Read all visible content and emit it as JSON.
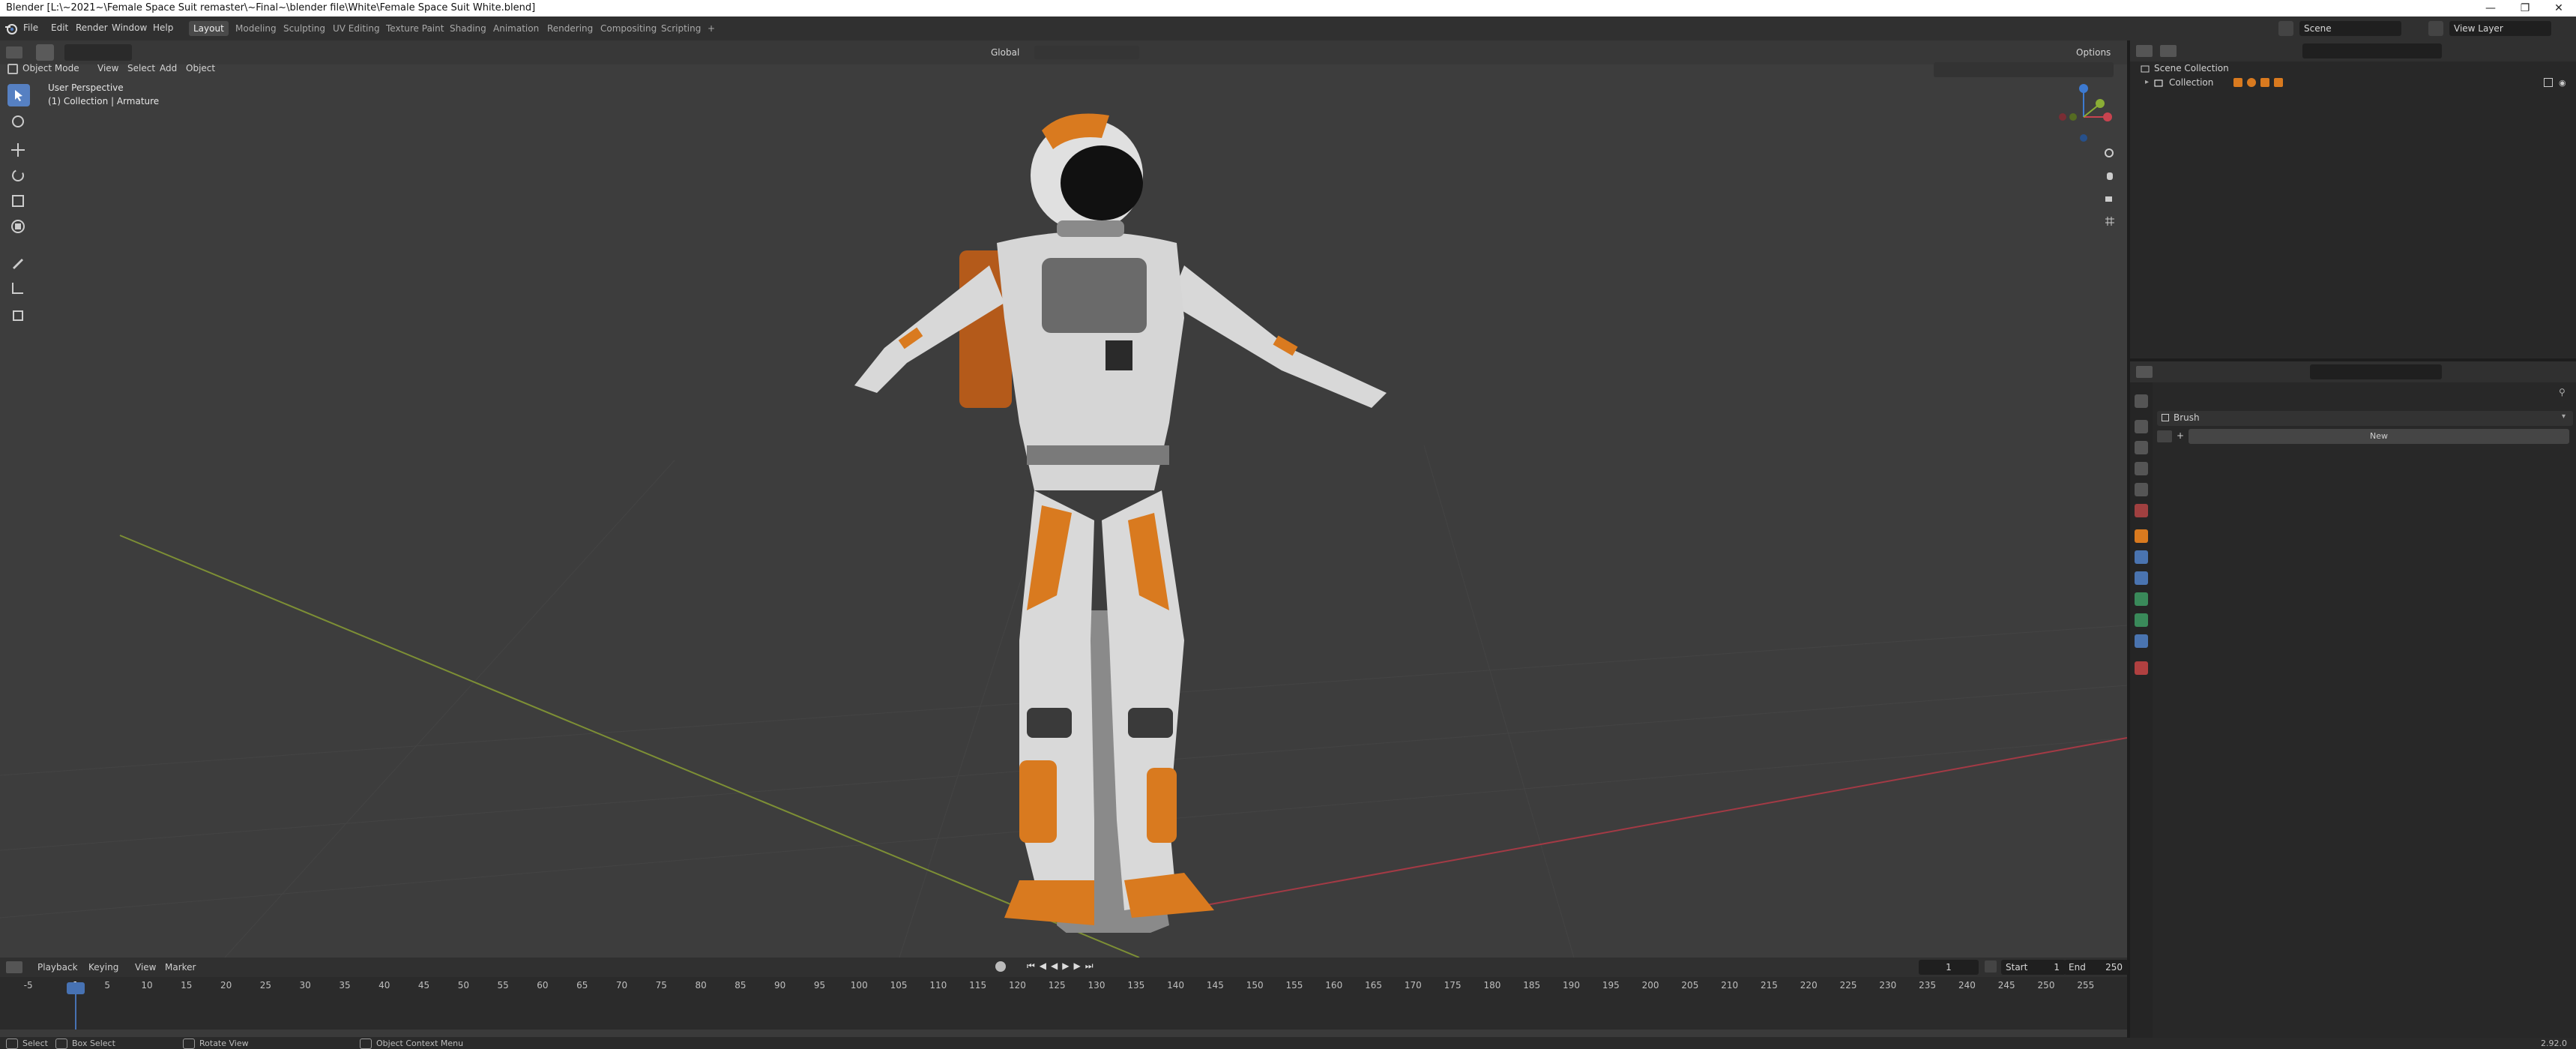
{
  "window": {
    "title": "Blender [L:\\~2021~\\Female Space Suit remaster\\~Final~\\blender file\\White\\Female Space Suit White.blend]",
    "controls": [
      "—",
      "❐",
      "✕"
    ]
  },
  "menubar": {
    "items": [
      "File",
      "Edit",
      "Render",
      "Window",
      "Help"
    ],
    "workspaces": [
      "Layout",
      "Modeling",
      "Sculpting",
      "UV Editing",
      "Texture Paint",
      "Shading",
      "Animation",
      "Rendering",
      "Compositing",
      "Scripting"
    ],
    "active_workspace": "Layout",
    "add_tab": "+",
    "scene": "Scene",
    "view_layer": "View Layer"
  },
  "viewport_header": {
    "mode": "Object Mode",
    "menus": [
      "View",
      "Select",
      "Add",
      "Object"
    ],
    "orientation": "Global",
    "options": "Options"
  },
  "viewport": {
    "perspective": "User Perspective",
    "collection_info": "(1) Collection | Armature",
    "gizmo_axes": [
      "X",
      "Y",
      "Z"
    ]
  },
  "outliner": {
    "root": "Scene Collection",
    "collection": "Collection",
    "search_placeholder": ""
  },
  "properties": {
    "brush_label": "Brush",
    "new_button": "New",
    "add_symbol": "+"
  },
  "timeline": {
    "menus": [
      "Playback",
      "Keying",
      "View",
      "Marker"
    ],
    "current_frame": "1",
    "start_label": "Start",
    "start_value": "1",
    "end_label": "End",
    "end_value": "250",
    "ticks": [
      "-5",
      "1",
      "5",
      "10",
      "15",
      "20",
      "25",
      "30",
      "35",
      "40",
      "45",
      "50",
      "55",
      "60",
      "65",
      "70",
      "75",
      "80",
      "85",
      "90",
      "95",
      "100",
      "105",
      "110",
      "115",
      "120",
      "125",
      "130",
      "135",
      "140",
      "145",
      "150",
      "155",
      "160",
      "165",
      "170",
      "175",
      "180",
      "185",
      "190",
      "195",
      "200",
      "205",
      "210",
      "215",
      "220",
      "225",
      "230",
      "235",
      "240",
      "245",
      "250",
      "255"
    ]
  },
  "statusbar": {
    "items": [
      "Select",
      "Box Select",
      "Rotate View",
      "Object Context Menu"
    ],
    "version": "2.92.0"
  },
  "colors": {
    "accent": "#4772b3",
    "x_axis": "#c8434f",
    "y_axis": "#8aad35",
    "z_axis": "#3d7ad1",
    "suit_orange": "#d97a1f"
  }
}
